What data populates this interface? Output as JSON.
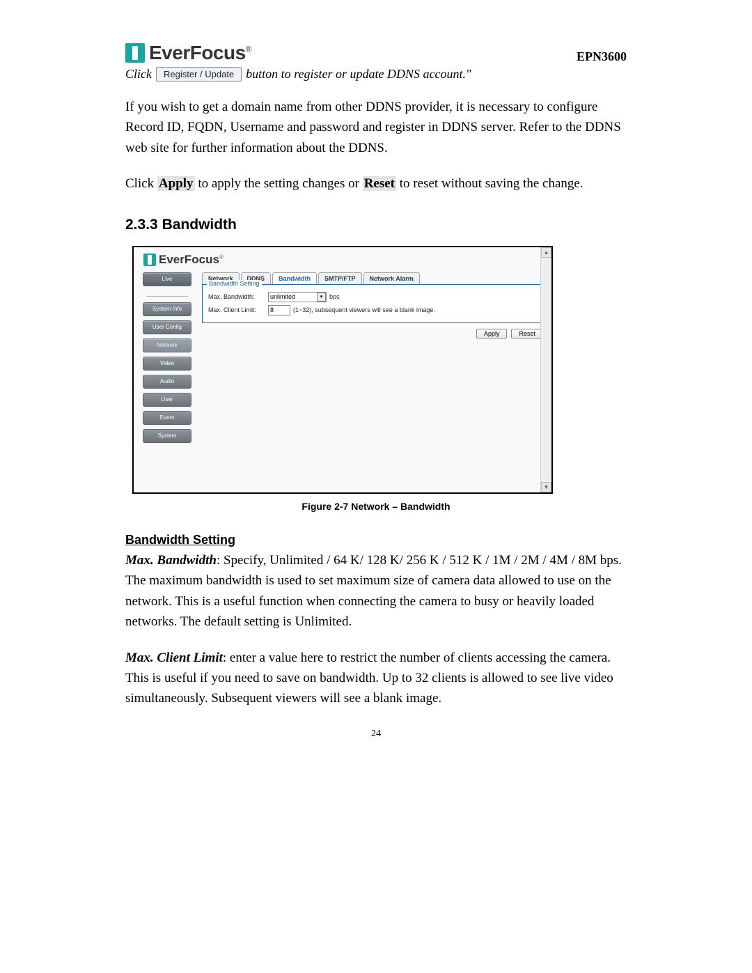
{
  "header": {
    "brand": "EverFocus",
    "model": "EPN3600"
  },
  "intro": {
    "click": "Click",
    "register_btn": "Register / Update",
    "after": "button to register or update DDNS account.\""
  },
  "para1": "If you wish to get a domain name from other DDNS provider, it is necessary to configure Record ID, FQDN, Username and password and register in DDNS server. Refer to the DDNS web site for further information about the DDNS.",
  "para2_a": "Click ",
  "para2_apply": "Apply",
  "para2_b": " to apply the setting changes or ",
  "para2_reset": "Reset",
  "para2_c": " to reset without saving the change.",
  "section_no": "2.3.3",
  "section_title": "Bandwidth",
  "figure": {
    "brand": "EverFocus",
    "sidebar": {
      "live": "Live",
      "items": [
        "System Info",
        "User Config",
        "Network",
        "Video",
        "Audio",
        "User",
        "Event",
        "System"
      ],
      "selected_index": 2
    },
    "tabs": [
      "Network",
      "DDNS",
      "Bandwidth",
      "SMTP/FTP",
      "Network Alarm"
    ],
    "active_tab": 2,
    "fieldset_legend": "Bandwidth Setting",
    "rows": {
      "max_bw_label": "Max. Bandwidth:",
      "max_bw_value": "unlimited",
      "max_bw_unit": "bps",
      "max_client_label": "Max. Client Limit:",
      "max_client_value": "8",
      "max_client_hint": "(1~32), subsequent viewers will see a blank image."
    },
    "apply": "Apply",
    "reset": "Reset",
    "caption": "Figure 2-7 Network – Bandwidth"
  },
  "sub_heading": "Bandwidth Setting",
  "max_bw_label": "Max. Bandwidth",
  "max_bw_desc": ": Specify, Unlimited / 64 K/ 128 K/ 256 K / 512 K / 1M / 2M / 4M / 8M bps. The maximum bandwidth is used to set maximum size of camera data allowed to use on the network. This is a useful function when connecting the camera to busy or heavily loaded networks. The default setting is Unlimited.",
  "max_client_label": "Max. Client Limit",
  "max_client_desc": ": enter a value here to restrict the number of clients accessing the camera. This is useful if you need to save on bandwidth. Up to 32 clients is allowed to see live video simultaneously. Subsequent viewers will see a blank image.",
  "page_number": "24"
}
